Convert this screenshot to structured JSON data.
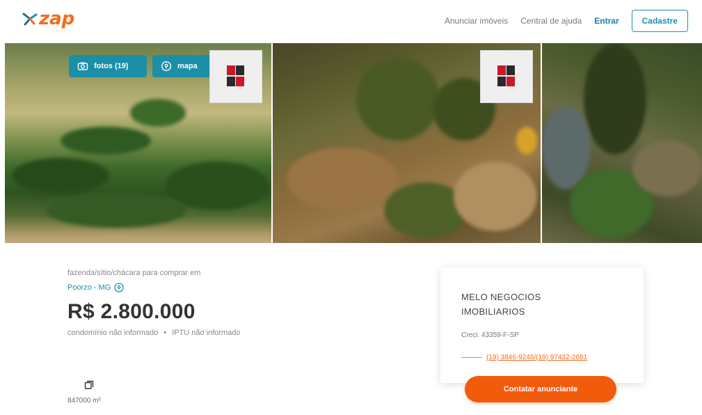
{
  "header": {
    "logo_text": "zap",
    "nav": {
      "announce_label": "Anunciar imóveis",
      "help_label": "Central de ajuda",
      "login_label": "Entrar",
      "signup_label": "Cadastre"
    }
  },
  "gallery": {
    "photos_chip_label": "fotos (19)",
    "map_chip_label": "mapa",
    "photos_chip_icon": "camera-icon",
    "map_chip_icon": "map-pin-icon"
  },
  "listing": {
    "subtitle": "fazenda/sítio/chácara para comprar em",
    "location": "Poorzo - MG",
    "price": "R$ 2.800.000",
    "condo_fee": "condomínio não informado",
    "iptu": "IPTU não informado",
    "area_icon": "area-icon",
    "area_value": "847000 m²"
  },
  "contact_card": {
    "agency_name": "MELO NEGOCIOS IMOBILIARIOS",
    "creci": "Creci: 43359-F-SP",
    "phones": "(19) 3846-9246/(19) 97432-2681",
    "contact_button_label": "Contatar anunciante"
  },
  "colors": {
    "brand_orange": "#f26b21",
    "accent_teal": "#1b8fa8",
    "cta_orange": "#f25a0c"
  }
}
